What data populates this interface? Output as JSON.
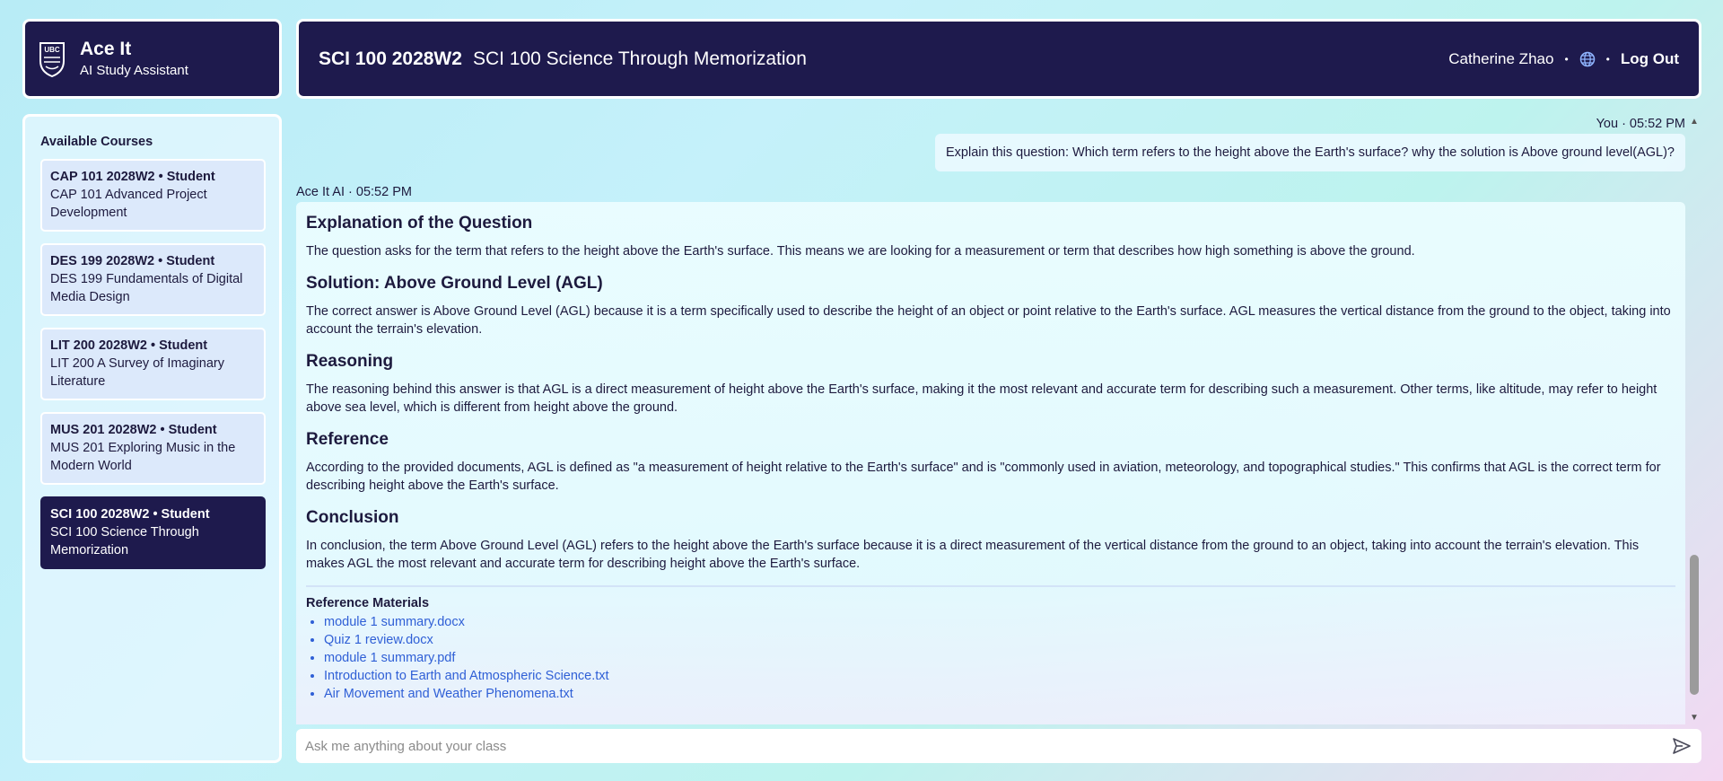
{
  "brand": {
    "title": "Ace It",
    "subtitle": "AI Study Assistant",
    "logo_icon": "ubc-crest-icon"
  },
  "header": {
    "course_code": "SCI 100 2028W2",
    "course_name": "SCI 100 Science Through Memorization",
    "user_name": "Catherine Zhao",
    "separator": "•",
    "language_icon": "globe-icon",
    "logout_label": "Log Out"
  },
  "sidebar": {
    "title": "Available Courses",
    "courses": [
      {
        "title": "CAP 101 2028W2 • Student",
        "name": "CAP 101 Advanced Project Development"
      },
      {
        "title": "DES 199 2028W2 • Student",
        "name": "DES 199 Fundamentals of Digital Media Design"
      },
      {
        "title": "LIT 200 2028W2 • Student",
        "name": "LIT 200 A Survey of Imaginary Literature"
      },
      {
        "title": "MUS 201 2028W2 • Student",
        "name": "MUS 201 Exploring Music in the Modern World"
      },
      {
        "title": "SCI 100 2028W2 • Student",
        "name": "SCI 100 Science Through Memorization",
        "active": true
      }
    ]
  },
  "chat": {
    "user_message": {
      "meta": "You · 05:52 PM",
      "text": "Explain this question: Which term refers to the height above the Earth's surface? why the solution is Above ground level(AGL)?"
    },
    "ai_message": {
      "meta": "Ace It AI · 05:52 PM",
      "sections": [
        {
          "heading": "Explanation of the Question",
          "body": "The question asks for the term that refers to the height above the Earth's surface. This means we are looking for a measurement or term that describes how high something is above the ground."
        },
        {
          "heading": "Solution: Above Ground Level (AGL)",
          "body": "The correct answer is Above Ground Level (AGL) because it is a term specifically used to describe the height of an object or point relative to the Earth's surface. AGL measures the vertical distance from the ground to the object, taking into account the terrain's elevation."
        },
        {
          "heading": "Reasoning",
          "body": "The reasoning behind this answer is that AGL is a direct measurement of height above the Earth's surface, making it the most relevant and accurate term for describing such a measurement. Other terms, like altitude, may refer to height above sea level, which is different from height above the ground."
        },
        {
          "heading": "Reference",
          "body": "According to the provided documents, AGL is defined as \"a measurement of height relative to the Earth's surface\" and is \"commonly used in aviation, meteorology, and topographical studies.\" This confirms that AGL is the correct term for describing height above the Earth's surface."
        },
        {
          "heading": "Conclusion",
          "body": "In conclusion, the term Above Ground Level (AGL) refers to the height above the Earth's surface because it is a direct measurement of the vertical distance from the ground to an object, taking into account the terrain's elevation. This makes AGL the most relevant and accurate term for describing height above the Earth's surface."
        }
      ],
      "references_title": "Reference Materials",
      "references": [
        "module 1 summary.docx",
        "Quiz 1 review.docx",
        "module 1 summary.pdf",
        "Introduction to Earth and Atmospheric Science.txt",
        "Air Movement and Weather Phenomena.txt"
      ]
    }
  },
  "input": {
    "placeholder": "Ask me anything about your class",
    "value": "",
    "send_icon": "send-icon"
  },
  "colors": {
    "navy": "#1e1a4d",
    "link": "#2f5fd6",
    "course_card": "#dce9fb"
  }
}
